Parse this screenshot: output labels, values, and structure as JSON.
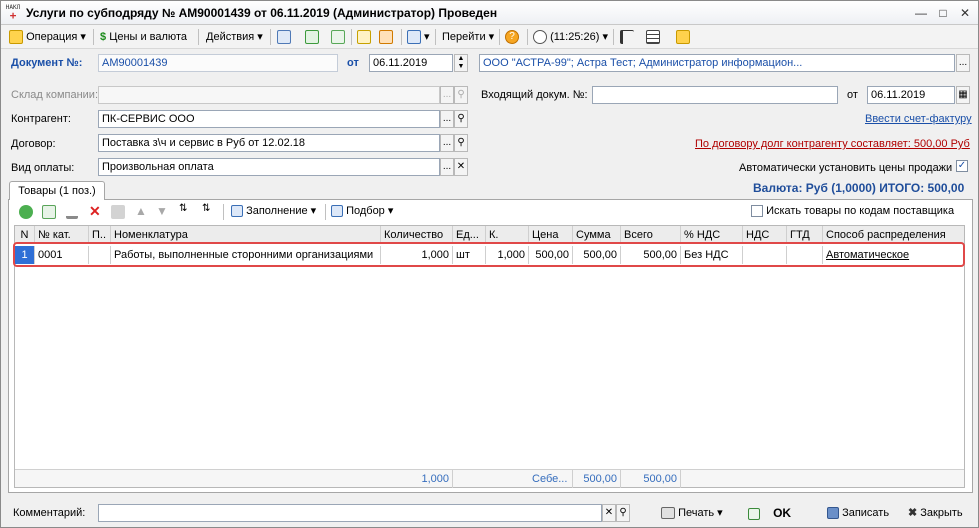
{
  "window": {
    "title": "Услуги по субподряду № АМ90001439 от 06.11.2019 (Администратор) Проведен",
    "app_icon_text": "НАКЛ"
  },
  "toolbar": {
    "operation": "Операция",
    "prices_currency": "Цены и валюта",
    "actions": "Действия",
    "goto": "Перейти",
    "time": "(11:25:26)"
  },
  "document": {
    "number_label": "Документ №:",
    "number": "АМ90001439",
    "date_label": "от",
    "date": "06.11.2019",
    "organization": "ООО \"АСТРА-99\"; Астра Тест; Администратор информацион..."
  },
  "form": {
    "warehouse_label": "Склад компании:",
    "warehouse": "",
    "incoming_doc_label": "Входящий докум. №:",
    "incoming_doc": "",
    "incoming_date_label": "от",
    "incoming_date": "06.11.2019",
    "contractor_label": "Контрагент:",
    "contractor": "ПК-СЕРВИС ООО",
    "invoice_link": "Ввести счет-фактуру",
    "contract_label": "Договор:",
    "contract": "Поставка з\\ч и сервис в Руб от 12.02.18",
    "debt_link": "По договору долг контрагенту составляет: 500,00 Руб",
    "payment_label": "Вид оплаты:",
    "payment": "Произвольная оплата",
    "auto_prices_label": "Автоматически установить цены продажи",
    "auto_prices_checked": true,
    "totals": "Валюта: Руб (1,0000) ИТОГО: 500,00"
  },
  "tab": {
    "goods_label": "Товары (1 поз.)"
  },
  "table_toolbar": {
    "fill": "Заполнение",
    "selection": "Подбор",
    "search_supplier_codes": "Искать товары по кодам поставщика"
  },
  "table": {
    "columns": [
      "N",
      "№ кат.",
      "П..",
      "Номенклатура",
      "Количество",
      "Ед...",
      "К.",
      "Цена",
      "Сумма",
      "Всего",
      "% НДС",
      "НДС",
      "ГТД",
      "Способ распределения"
    ],
    "rows": [
      {
        "n": "1",
        "cat": "0001",
        "p": "",
        "name": "Работы, выполненные сторонними организациями",
        "qty": "1,000",
        "unit": "шт",
        "k": "1,000",
        "price": "500,00",
        "sum": "500,00",
        "total": "500,00",
        "vat_rate": "Без НДС",
        "vat": "",
        "gtd": "",
        "distribution": "Автоматическое"
      }
    ],
    "footer": {
      "qty": "1,000",
      "price": "Себе...",
      "sum": "500,00",
      "total": "500,00"
    }
  },
  "bottom": {
    "comment_label": "Комментарий:",
    "comment": "",
    "print": "Печать",
    "ok": "OK",
    "save": "Записать",
    "close": "Закрыть"
  },
  "colors": {
    "link_blue": "#1a4fa8",
    "debt_red": "#b00000",
    "totals_blue": "#1f4d9a",
    "highlight": "#e04848"
  }
}
